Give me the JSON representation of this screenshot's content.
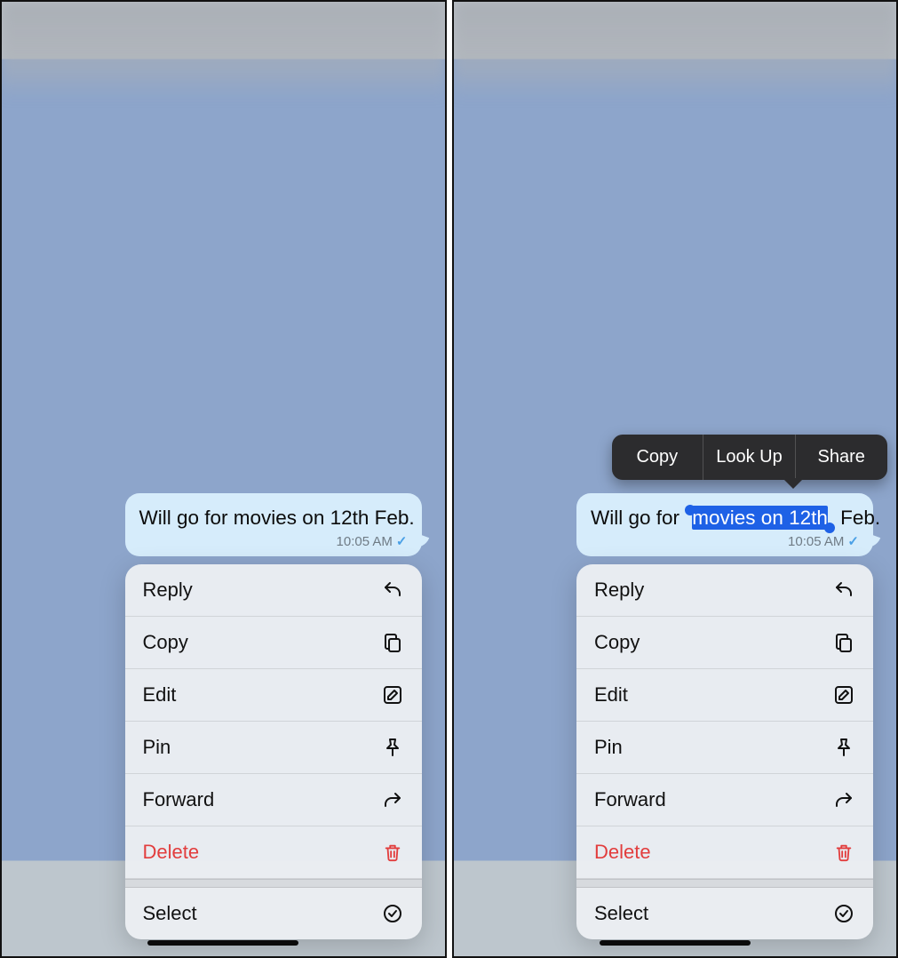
{
  "left": {
    "message": {
      "prefix": "Will go for ",
      "mid": "movies on 12th",
      "suffix": " Feb.",
      "time": "10:05 AM"
    },
    "menu": {
      "reply": "Reply",
      "copy": "Copy",
      "edit": "Edit",
      "pin": "Pin",
      "forward": "Forward",
      "delete": "Delete",
      "select": "Select"
    }
  },
  "right": {
    "message": {
      "prefix": "Will go for ",
      "mid": "movies on 12th",
      "suffix": " Feb.",
      "time": "10:05 AM"
    },
    "callout": {
      "copy": "Copy",
      "lookup": "Look Up",
      "share": "Share"
    },
    "menu": {
      "reply": "Reply",
      "copy": "Copy",
      "edit": "Edit",
      "pin": "Pin",
      "forward": "Forward",
      "delete": "Delete",
      "select": "Select"
    }
  }
}
